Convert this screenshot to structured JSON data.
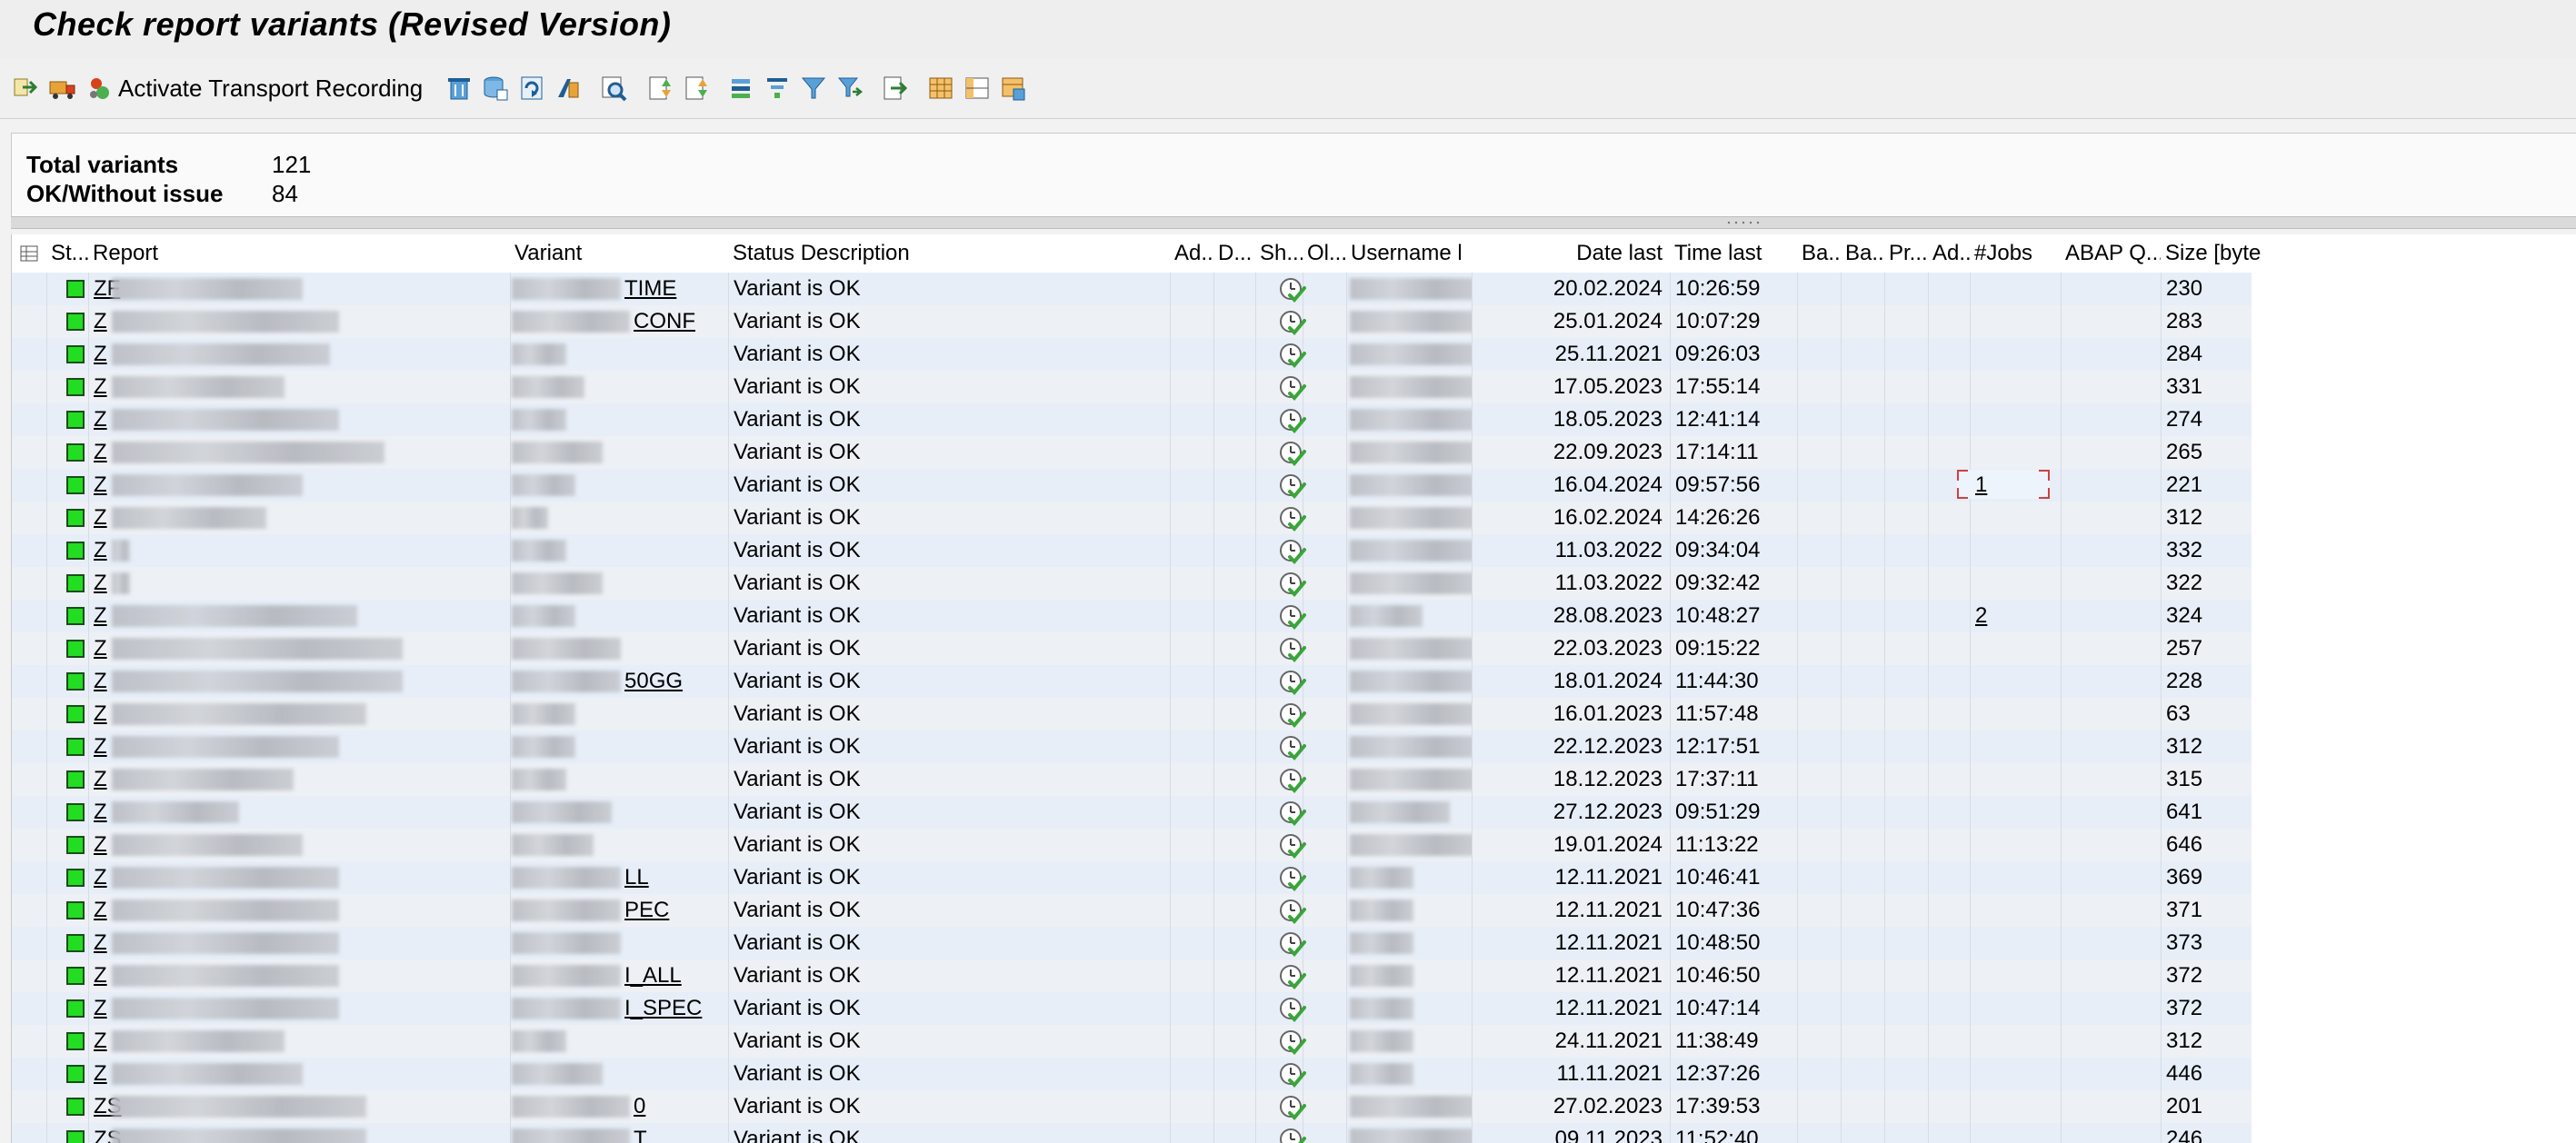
{
  "title": "Check report variants (Revised Version)",
  "toolbar": {
    "activate_transport_label": "Activate Transport Recording"
  },
  "summary": {
    "total_label": "Total variants",
    "total_value": "121",
    "ok_label": "OK/Without issue",
    "ok_value": "84"
  },
  "columns": [
    {
      "id": "st",
      "label": "St..."
    },
    {
      "id": "report",
      "label": "Report"
    },
    {
      "id": "variant",
      "label": "Variant"
    },
    {
      "id": "status",
      "label": "Status Description"
    },
    {
      "id": "ad1",
      "label": "Ad..."
    },
    {
      "id": "d",
      "label": "D..."
    },
    {
      "id": "sh",
      "label": "Sh..."
    },
    {
      "id": "ol",
      "label": "Ol..."
    },
    {
      "id": "user",
      "label": "Username l"
    },
    {
      "id": "date",
      "label": "Date last"
    },
    {
      "id": "time",
      "label": "Time last"
    },
    {
      "id": "ba1",
      "label": "Ba..."
    },
    {
      "id": "ba2",
      "label": "Ba..."
    },
    {
      "id": "pr",
      "label": "Pr..."
    },
    {
      "id": "ad2",
      "label": "Ad..."
    },
    {
      "id": "jobs",
      "label": "#Jobs"
    },
    {
      "id": "abap",
      "label": "ABAP Q..."
    },
    {
      "id": "size",
      "label": "Size [byte"
    }
  ],
  "rows": [
    {
      "report": "ZF",
      "variant": "TIME",
      "status": "Variant is OK",
      "date": "20.02.2024",
      "time": "10:26:59",
      "jobs": "",
      "size": "230"
    },
    {
      "report": "Z",
      "variant": "CONF",
      "status": "Variant is OK",
      "date": "25.01.2024",
      "time": "10:07:29",
      "jobs": "",
      "size": "283"
    },
    {
      "report": "Z",
      "variant": "",
      "status": "Variant is OK",
      "date": "25.11.2021",
      "time": "09:26:03",
      "jobs": "",
      "size": "284"
    },
    {
      "report": "Z",
      "variant": "",
      "status": "Variant is OK",
      "date": "17.05.2023",
      "time": "17:55:14",
      "jobs": "",
      "size": "331"
    },
    {
      "report": "Z",
      "variant": "",
      "status": "Variant is OK",
      "date": "18.05.2023",
      "time": "12:41:14",
      "jobs": "",
      "size": "274"
    },
    {
      "report": "Z",
      "variant": "",
      "status": "Variant is OK",
      "date": "22.09.2023",
      "time": "17:14:11",
      "jobs": "",
      "size": "265"
    },
    {
      "report": "Z",
      "variant": "",
      "status": "Variant is OK",
      "date": "16.04.2024",
      "time": "09:57:56",
      "jobs": "1",
      "size": "221"
    },
    {
      "report": "Z",
      "variant": "",
      "status": "Variant is OK",
      "date": "16.02.2024",
      "time": "14:26:26",
      "jobs": "",
      "size": "312"
    },
    {
      "report": "Z",
      "variant": "",
      "status": "Variant is OK",
      "date": "11.03.2022",
      "time": "09:34:04",
      "jobs": "",
      "size": "332"
    },
    {
      "report": "Z",
      "variant": "",
      "status": "Variant is OK",
      "date": "11.03.2022",
      "time": "09:32:42",
      "jobs": "",
      "size": "322"
    },
    {
      "report": "Z",
      "variant": "",
      "status": "Variant is OK",
      "date": "28.08.2023",
      "time": "10:48:27",
      "jobs": "2",
      "size": "324"
    },
    {
      "report": "Z",
      "variant": "",
      "status": "Variant is OK",
      "date": "22.03.2023",
      "time": "09:15:22",
      "jobs": "",
      "size": "257"
    },
    {
      "report": "Z",
      "variant": "50GG",
      "status": "Variant is OK",
      "date": "18.01.2024",
      "time": "11:44:30",
      "jobs": "",
      "size": "228"
    },
    {
      "report": "Z",
      "variant": "",
      "status": "Variant is OK",
      "date": "16.01.2023",
      "time": "11:57:48",
      "jobs": "",
      "size": "63"
    },
    {
      "report": "Z",
      "variant": "",
      "status": "Variant is OK",
      "date": "22.12.2023",
      "time": "12:17:51",
      "jobs": "",
      "size": "312"
    },
    {
      "report": "Z",
      "variant": "",
      "status": "Variant is OK",
      "date": "18.12.2023",
      "time": "17:37:11",
      "jobs": "",
      "size": "315"
    },
    {
      "report": "Z",
      "variant": "",
      "status": "Variant is OK",
      "date": "27.12.2023",
      "time": "09:51:29",
      "jobs": "",
      "size": "641"
    },
    {
      "report": "Z",
      "variant": "",
      "status": "Variant is OK",
      "date": "19.01.2024",
      "time": "11:13:22",
      "jobs": "",
      "size": "646"
    },
    {
      "report": "Z",
      "variant": "LL",
      "status": "Variant is OK",
      "date": "12.11.2021",
      "time": "10:46:41",
      "jobs": "",
      "size": "369"
    },
    {
      "report": "Z",
      "variant": "PEC",
      "status": "Variant is OK",
      "date": "12.11.2021",
      "time": "10:47:36",
      "jobs": "",
      "size": "371"
    },
    {
      "report": "Z",
      "variant": "",
      "status": "Variant is OK",
      "date": "12.11.2021",
      "time": "10:48:50",
      "jobs": "",
      "size": "373"
    },
    {
      "report": "Z",
      "variant": "I_ALL",
      "status": "Variant is OK",
      "date": "12.11.2021",
      "time": "10:46:50",
      "jobs": "",
      "size": "372"
    },
    {
      "report": "Z",
      "variant": "I_SPEC",
      "status": "Variant is OK",
      "date": "12.11.2021",
      "time": "10:47:14",
      "jobs": "",
      "size": "372"
    },
    {
      "report": "Z",
      "variant": "",
      "status": "Variant is OK",
      "date": "24.11.2021",
      "time": "11:38:49",
      "jobs": "",
      "size": "312"
    },
    {
      "report": "Z",
      "variant": "",
      "status": "Variant is OK",
      "date": "11.11.2021",
      "time": "12:37:26",
      "jobs": "",
      "size": "446"
    },
    {
      "report": "ZS",
      "variant": "0",
      "status": "Variant is OK",
      "date": "27.02.2023",
      "time": "17:39:53",
      "jobs": "",
      "size": "201"
    },
    {
      "report": "ZS",
      "variant": "T",
      "status": "Variant is OK",
      "date": "09.11.2023",
      "time": "11:52:40",
      "jobs": "",
      "size": "246"
    }
  ],
  "colors": {
    "row_odd": "#e7eef8",
    "row_even": "#edf0f5",
    "status_ok": "#22dd22",
    "check_green": "#3aa53a"
  },
  "icons": {
    "status": "green-square-icon",
    "shown": "clock-check-icon"
  }
}
